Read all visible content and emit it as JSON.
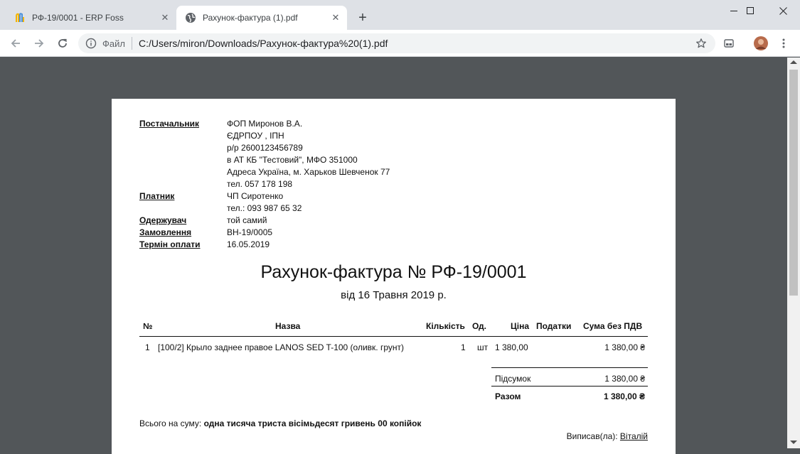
{
  "browser": {
    "tabs": [
      {
        "title": "РФ-19/0001 - ERP Foss",
        "active": false
      },
      {
        "title": "Рахунок-фактура (1).pdf",
        "active": true
      }
    ],
    "new_tab_symbol": "+",
    "window_controls": {
      "minimize": "—",
      "maximize": "☐",
      "close": "✕"
    },
    "omnibox": {
      "scheme_label": "Файл",
      "url": "C:/Users/miron/Downloads/Рахунок-фактура%20(1).pdf"
    },
    "icons": [
      "back-icon",
      "forward-icon",
      "reload-icon",
      "info-icon",
      "star-icon",
      "extension-icon",
      "avatar",
      "menu-icon"
    ]
  },
  "invoice": {
    "supplier": {
      "label": "Постачальник",
      "lines": [
        "ФОП Миронов В.А.",
        "ЄДРПОУ , ІПН",
        "р/р 2600123456789",
        "в АТ КБ \"Тестовий\", МФО 351000",
        "Адреса Україна, м. Харьков Шевченок 77",
        "тел. 057 178 198"
      ]
    },
    "payer": {
      "label": "Платник",
      "lines": [
        "ЧП Сиротенко",
        "тел.: 093 987 65 32"
      ]
    },
    "recipient": {
      "label": "Одержувач",
      "value": "той самий"
    },
    "order": {
      "label": "Замовлення",
      "value": "ВН-19/0005"
    },
    "due": {
      "label": "Термін оплати",
      "value": "16.05.2019"
    },
    "title": "Рахунок-фактура № РФ-19/0001",
    "date": "від 16 Травня 2019 р.",
    "table": {
      "headers": {
        "num": "№",
        "name": "Назва",
        "qty": "Кількість",
        "unit": "Од.",
        "price": "Ціна",
        "taxes": "Податки",
        "sum": "Сума без ПДВ"
      },
      "rows": [
        {
          "num": "1",
          "name": "[100/2] Крыло заднее правое LANOS SED T-100 (оливк. грунт)",
          "qty": "1",
          "unit": "шт",
          "price": "1 380,00",
          "taxes": "",
          "sum": "1 380,00 ₴"
        }
      ]
    },
    "subtotal": {
      "label": "Підсумок",
      "value": "1 380,00 ₴"
    },
    "total": {
      "label": "Разом",
      "value": "1 380,00 ₴"
    },
    "sum_in_words": {
      "label": "Всього на суму:",
      "value": "одна тисяча триста вісімьдесят гривень 00 копійок"
    },
    "signed": {
      "label": "Виписав(ла):",
      "name": "Віталій"
    }
  }
}
